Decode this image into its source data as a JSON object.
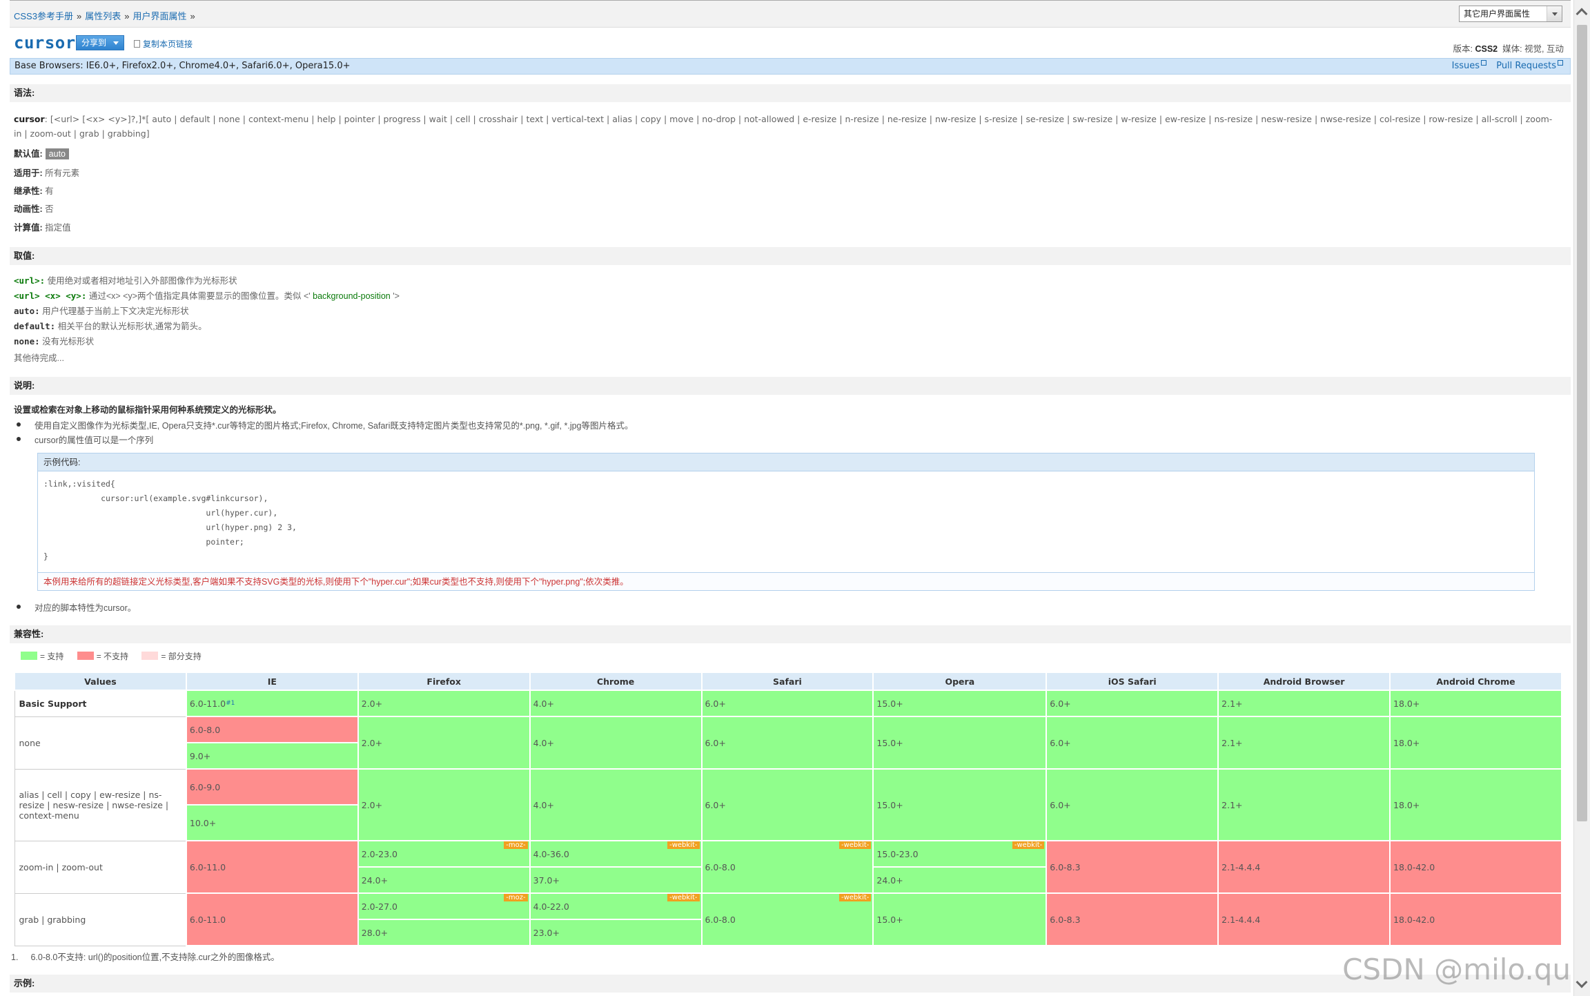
{
  "breadcrumb": [
    "CSS3参考手册",
    "属性列表",
    "用户界面属性"
  ],
  "breadcrumb_sep": "»",
  "select": {
    "value": "其它用户界面属性"
  },
  "title": "cursor",
  "share_label": "分享到",
  "copy_link_label": "复制本页链接",
  "version": {
    "label": "版本:",
    "value": "CSS2",
    "media": "媒体: 视觉, 互动"
  },
  "base_browsers": "Base Browsers: IE6.0+, Firefox2.0+, Chrome4.0+, Safari6.0+, Opera15.0+",
  "issues_label": "Issues",
  "pull_requests_label": "Pull Requests",
  "sections": {
    "syntax": "语法:",
    "values": "取值:",
    "desc": "说明:",
    "compat": "兼容性:",
    "example": "示例:"
  },
  "syntax_name": "cursor",
  "syntax_text": ": [<url> [<x> <y>]?,]*[ auto | default | none | context-menu | help | pointer | progress | wait | cell | crosshair | text | vertical-text | alias | copy | move | no-drop | not-allowed | e-resize | n-resize | ne-resize | nw-resize | s-resize | se-resize | sw-resize | w-resize | ew-resize | ns-resize | nesw-resize | nwse-resize | col-resize | row-resize | all-scroll | zoom-in | zoom-out | grab | grabbing]",
  "props": {
    "default_label": "默认值:",
    "default_value": "auto",
    "applies_label": "适用于:",
    "applies_value": "所有元素",
    "inherit_label": "继承性:",
    "inherit_value": "有",
    "anim_label": "动画性:",
    "anim_value": "否",
    "computed_label": "计算值:",
    "computed_value": "指定值"
  },
  "values": [
    {
      "key": "<url>:",
      "text": "使用绝对或者相对地址引入外部图像作为光标形状"
    },
    {
      "key": "<url> <x> <y>:",
      "text": "通过<x> <y>两个值指定具体需要显示的图像位置。类似 <' ",
      "link": "background-position",
      "tail": " '>"
    },
    {
      "key": "auto:",
      "text": "用户代理基于当前上下文决定光标形状"
    },
    {
      "key": "default:",
      "text": "相关平台的默认光标形状,通常为箭头。"
    },
    {
      "key": "none:",
      "text": "没有光标形状"
    }
  ],
  "values_more": "其他待完成...",
  "desc_lead": "设置或检索在对象上移动的鼠标指针采用何种系统预定义的光标形状。",
  "desc_bullets": [
    "使用自定义图像作为光标类型,IE, Opera只支持*.cur等特定的图片格式;Firefox, Chrome, Safari既支持特定图片类型也支持常见的*.png, *.gif, *.jpg等图片格式。",
    "cursor的属性值可以是一个序列"
  ],
  "code": {
    "header": "示例代码:",
    "body": ":link,:visited{\n            cursor:url(example.svg#linkcursor),\n                                  url(hyper.cur),\n                                  url(hyper.png) 2 3,\n                                  pointer;\n}",
    "note": "本例用来给所有的超链接定义光标类型,客户端如果不支持SVG类型的光标,则使用下个\"hyper.cur\";如果cur类型也不支持,则使用下个\"hyper.png\";依次类推。"
  },
  "desc_bullet_last": "对应的脚本特性为cursor。",
  "legend": [
    {
      "color": "#90fe8c",
      "label": "= 支持"
    },
    {
      "color": "#fe8d8d",
      "label": "= 不支持"
    },
    {
      "color": "#ffdada",
      "label": "= 部分支持"
    }
  ],
  "compat": {
    "headers": [
      "Values",
      "IE",
      "Firefox",
      "Chrome",
      "Safari",
      "Opera",
      "iOS Safari",
      "Android Browser",
      "Android Chrome"
    ],
    "rows": [
      {
        "label": "Basic Support",
        "bold": true,
        "height": 36,
        "cells": [
          [
            {
              "v": "6.0-11.0",
              "s": "ok",
              "sup": "#1"
            }
          ],
          [
            {
              "v": "2.0+",
              "s": "ok"
            }
          ],
          [
            {
              "v": "4.0+",
              "s": "ok"
            }
          ],
          [
            {
              "v": "6.0+",
              "s": "ok"
            }
          ],
          [
            {
              "v": "15.0+",
              "s": "ok"
            }
          ],
          [
            {
              "v": "6.0+",
              "s": "ok"
            }
          ],
          [
            {
              "v": "2.1+",
              "s": "ok"
            }
          ],
          [
            {
              "v": "18.0+",
              "s": "ok"
            }
          ]
        ]
      },
      {
        "label": "none",
        "height": 74,
        "cells": [
          [
            {
              "v": "6.0-8.0",
              "s": "no"
            },
            {
              "v": "9.0+",
              "s": "ok"
            }
          ],
          [
            {
              "v": "2.0+",
              "s": "ok"
            }
          ],
          [
            {
              "v": "4.0+",
              "s": "ok"
            }
          ],
          [
            {
              "v": "6.0+",
              "s": "ok"
            }
          ],
          [
            {
              "v": "15.0+",
              "s": "ok"
            }
          ],
          [
            {
              "v": "6.0+",
              "s": "ok"
            }
          ],
          [
            {
              "v": "2.1+",
              "s": "ok"
            }
          ],
          [
            {
              "v": "18.0+",
              "s": "ok"
            }
          ]
        ]
      },
      {
        "label": "alias | cell | copy | ew-resize | ns-resize | nesw-resize | nwse-resize | context-menu",
        "height": 102,
        "cells": [
          [
            {
              "v": "6.0-9.0",
              "s": "no"
            },
            {
              "v": "10.0+",
              "s": "ok"
            }
          ],
          [
            {
              "v": "2.0+",
              "s": "ok"
            }
          ],
          [
            {
              "v": "4.0+",
              "s": "ok"
            }
          ],
          [
            {
              "v": "6.0+",
              "s": "ok"
            }
          ],
          [
            {
              "v": "15.0+",
              "s": "ok"
            }
          ],
          [
            {
              "v": "6.0+",
              "s": "ok"
            }
          ],
          [
            {
              "v": "2.1+",
              "s": "ok"
            }
          ],
          [
            {
              "v": "18.0+",
              "s": "ok"
            }
          ]
        ]
      },
      {
        "label": "zoom-in | zoom-out",
        "height": 74,
        "cells": [
          [
            {
              "v": "6.0-11.0",
              "s": "no"
            }
          ],
          [
            {
              "v": "2.0-23.0",
              "s": "ok",
              "p": "-moz-"
            },
            {
              "v": "24.0+",
              "s": "ok"
            }
          ],
          [
            {
              "v": "4.0-36.0",
              "s": "ok",
              "p": "-webkit-"
            },
            {
              "v": "37.0+",
              "s": "ok"
            }
          ],
          [
            {
              "v": "6.0-8.0",
              "s": "ok",
              "p": "-webkit-"
            }
          ],
          [
            {
              "v": "15.0-23.0",
              "s": "ok",
              "p": "-webkit-"
            },
            {
              "v": "24.0+",
              "s": "ok"
            }
          ],
          [
            {
              "v": "6.0-8.3",
              "s": "no"
            }
          ],
          [
            {
              "v": "2.1-4.4.4",
              "s": "no"
            }
          ],
          [
            {
              "v": "18.0-42.0",
              "s": "no"
            }
          ]
        ]
      },
      {
        "label": "grab | grabbing",
        "height": 74,
        "cells": [
          [
            {
              "v": "6.0-11.0",
              "s": "no"
            }
          ],
          [
            {
              "v": "2.0-27.0",
              "s": "ok",
              "p": "-moz-"
            },
            {
              "v": "28.0+",
              "s": "ok"
            }
          ],
          [
            {
              "v": "4.0-22.0",
              "s": "ok",
              "p": "-webkit-"
            },
            {
              "v": "23.0+",
              "s": "ok"
            }
          ],
          [
            {
              "v": "6.0-8.0",
              "s": "ok",
              "p": "-webkit-"
            }
          ],
          [
            {
              "v": "15.0+",
              "s": "ok"
            }
          ],
          [
            {
              "v": "6.0-8.3",
              "s": "no"
            }
          ],
          [
            {
              "v": "2.1-4.4.4",
              "s": "no"
            }
          ],
          [
            {
              "v": "18.0-42.0",
              "s": "no"
            }
          ]
        ]
      }
    ]
  },
  "footnote": {
    "num": "1.",
    "text": "6.0-8.0不支持: url()的position位置,不支持除.cur之外的图像格式。"
  },
  "watermark": "CSDN @milo.qu"
}
